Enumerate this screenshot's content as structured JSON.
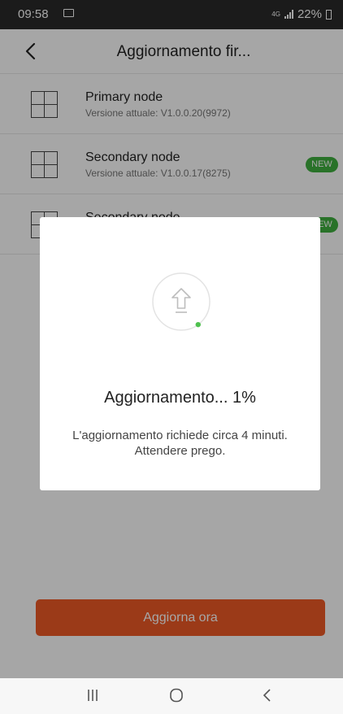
{
  "status_bar": {
    "time": "09:58",
    "network": "4G",
    "battery": "22%"
  },
  "header": {
    "title": "Aggiornamento fir..."
  },
  "nodes": [
    {
      "name": "Primary node",
      "version": "Versione attuale: V1.0.0.20(9972)",
      "badge": ""
    },
    {
      "name": "Secondary node",
      "version": "Versione attuale: V1.0.0.17(8275)",
      "badge": "NEW"
    },
    {
      "name": "Secondary node",
      "version": "",
      "badge": "NEW"
    }
  ],
  "update_button": {
    "label": "Aggiorna ora"
  },
  "dialog": {
    "title": "Aggiornamento... 1%",
    "progress_percent": 1,
    "message_line1": "L'aggiornamento richiede circa 4 minuti.",
    "message_line2": "Attendere prego."
  },
  "colors": {
    "accent": "#ef5a26",
    "badge": "#3fb03f",
    "status_bar": "#2a2a2a"
  },
  "icons": {
    "back": "chevron-left-icon",
    "device": "grid-icon",
    "upload": "arrow-up-icon",
    "nav_recents": "recents-icon",
    "nav_home": "home-icon",
    "nav_back": "back-icon"
  }
}
